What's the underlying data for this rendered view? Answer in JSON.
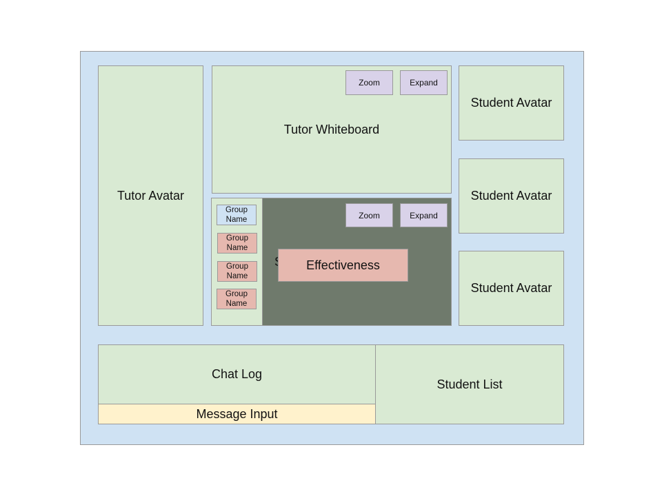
{
  "tutor_avatar": {
    "label": "Tutor Avatar"
  },
  "tutor_whiteboard": {
    "label": "Tutor Whiteboard",
    "zoom_label": "Zoom",
    "expand_label": "Expand"
  },
  "student_avatars": [
    {
      "label": "Student Avatar"
    },
    {
      "label": "Student Avatar"
    },
    {
      "label": "Student Avatar"
    }
  ],
  "group_panel": {
    "groups": [
      {
        "label": "Group Name",
        "selected": true
      },
      {
        "label": "Group Name",
        "selected": false
      },
      {
        "label": "Group Name",
        "selected": false
      },
      {
        "label": "Group Name",
        "selected": false
      }
    ],
    "hidden_label_fragment": "S",
    "zoom_label": "Zoom",
    "expand_label": "Expand",
    "effectiveness_label": "Effectiveness"
  },
  "chat": {
    "log_label": "Chat Log",
    "input_label": "Message Input"
  },
  "student_list": {
    "label": "Student List"
  },
  "colors": {
    "frame": "#cfe2f3",
    "panel": "#d9ead3",
    "button": "#d9d2e9",
    "group": "#e6b8af",
    "group_selected": "#cfe2f3",
    "whiteboard_dark": "#6f7a6c",
    "input": "#fff2cc"
  }
}
